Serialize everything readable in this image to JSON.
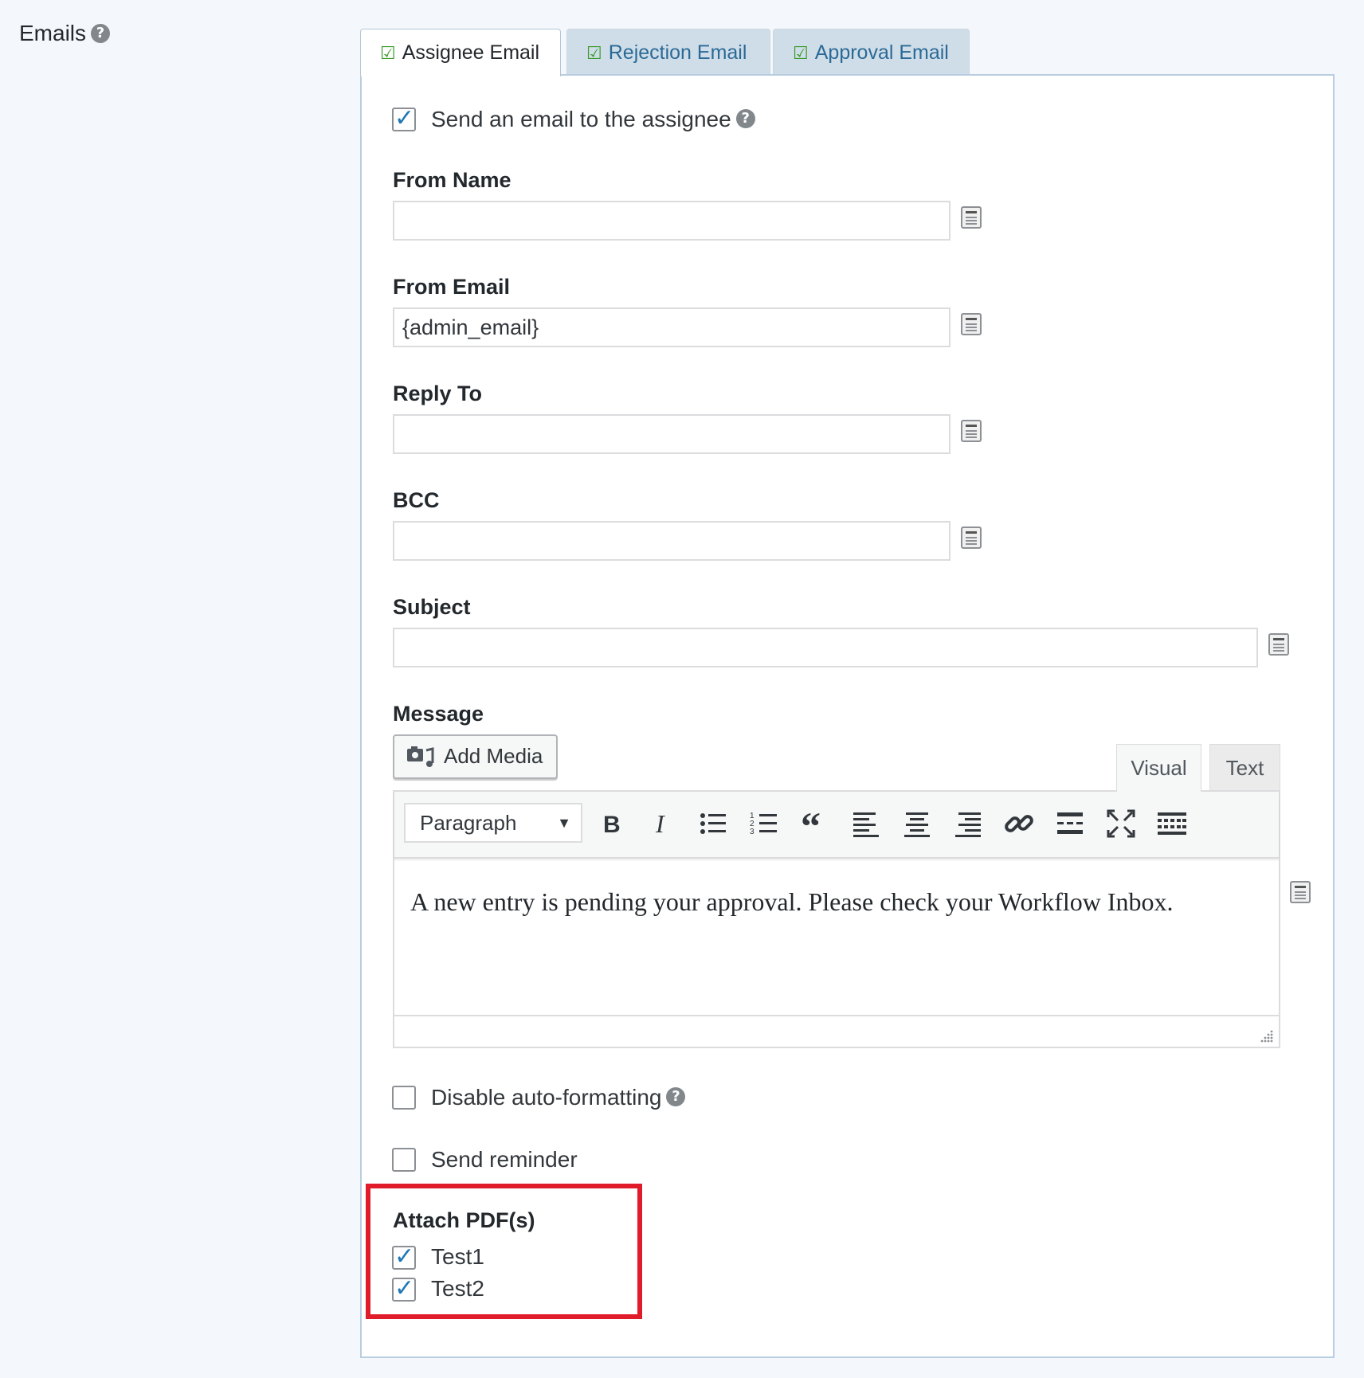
{
  "section": {
    "label": "Emails"
  },
  "tabs": [
    {
      "label": "Assignee Email",
      "active": true
    },
    {
      "label": "Rejection Email",
      "active": false
    },
    {
      "label": "Approval Email",
      "active": false
    }
  ],
  "send_email": {
    "label": "Send an email to the assignee",
    "checked": true
  },
  "fields": {
    "from_name": {
      "label": "From Name",
      "value": ""
    },
    "from_email": {
      "label": "From Email",
      "value": "{admin_email}"
    },
    "reply_to": {
      "label": "Reply To",
      "value": ""
    },
    "bcc": {
      "label": "BCC",
      "value": ""
    },
    "subject": {
      "label": "Subject",
      "value": ""
    }
  },
  "message": {
    "label": "Message",
    "add_media": "Add Media",
    "editor_tabs": {
      "visual": "Visual",
      "text": "Text"
    },
    "format": "Paragraph",
    "toolbar_icons": [
      "bold-icon",
      "italic-icon",
      "bullet-list-icon",
      "numbered-list-icon",
      "blockquote-icon",
      "align-left-icon",
      "align-center-icon",
      "align-right-icon",
      "link-icon",
      "read-more-icon",
      "fullscreen-icon",
      "toolbar-toggle-icon"
    ],
    "content": "A new entry is pending your approval. Please check your Workflow Inbox."
  },
  "disable_autoformat": {
    "label": "Disable auto-formatting",
    "checked": false
  },
  "send_reminder": {
    "label": "Send reminder",
    "checked": false
  },
  "attach_pdfs": {
    "label": "Attach PDF(s)",
    "items": [
      {
        "label": "Test1",
        "checked": true
      },
      {
        "label": "Test2",
        "checked": true
      }
    ]
  },
  "colors": {
    "highlight": "#e01c2b",
    "check": "#1e78b4",
    "tab_check": "#3a9a29",
    "inactive_tab": "#cfdde8"
  }
}
